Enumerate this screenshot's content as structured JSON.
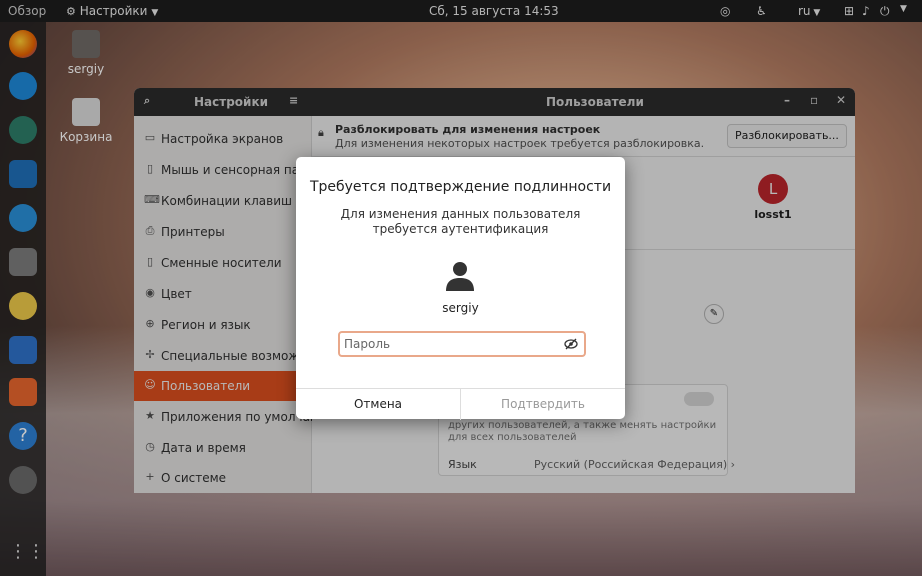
{
  "topbar": {
    "activities": "Обзор",
    "app_menu": "Настройки",
    "clock": "Сб, 15 августа  14:53",
    "keyboard_layout": "ru"
  },
  "desktop": {
    "home_label": "sergiy",
    "trash_label": "Корзина"
  },
  "settings_window": {
    "search_title": "Настройки",
    "title": "Пользователи",
    "sidebar": [
      {
        "label": "Настройка экранов",
        "icon": "display-icon"
      },
      {
        "label": "Мышь и сенсорная панель",
        "icon": "mouse-icon"
      },
      {
        "label": "Комбинации клавиш",
        "icon": "keyboard-icon"
      },
      {
        "label": "Принтеры",
        "icon": "printer-icon"
      },
      {
        "label": "Сменные носители",
        "icon": "media-icon"
      },
      {
        "label": "Цвет",
        "icon": "color-icon"
      },
      {
        "label": "Регион и язык",
        "icon": "globe-icon"
      },
      {
        "label": "Специальные возможности",
        "icon": "accessibility-icon"
      },
      {
        "label": "Пользователи",
        "icon": "user-icon"
      },
      {
        "label": "Приложения по умолчанию",
        "icon": "star-icon"
      },
      {
        "label": "Дата и время",
        "icon": "clock-icon"
      },
      {
        "label": "О системе",
        "icon": "plus-icon"
      }
    ],
    "unlock_banner": {
      "title": "Разблокировать для изменения настроек",
      "subtitle": "Для изменения некоторых настроек требуется разблокировка.",
      "button": "Разблокировать..."
    },
    "user_avatar_letter": "L",
    "user_name": "losst1",
    "admin_text_1": "других пользователей, а также менять настройки",
    "admin_text_2": "для всех пользователей",
    "language_label": "Язык",
    "language_value": "Русский (Российская Федерация)"
  },
  "auth_dialog": {
    "title": "Требуется подтверждение подлинности",
    "message": "Для изменения данных пользователя требуется аутентификация",
    "username": "sergiy",
    "password_placeholder": "Пароль",
    "cancel": "Отмена",
    "confirm": "Подтвердить"
  },
  "colors": {
    "accent": "#e95420",
    "avatar": "#c7272e"
  }
}
